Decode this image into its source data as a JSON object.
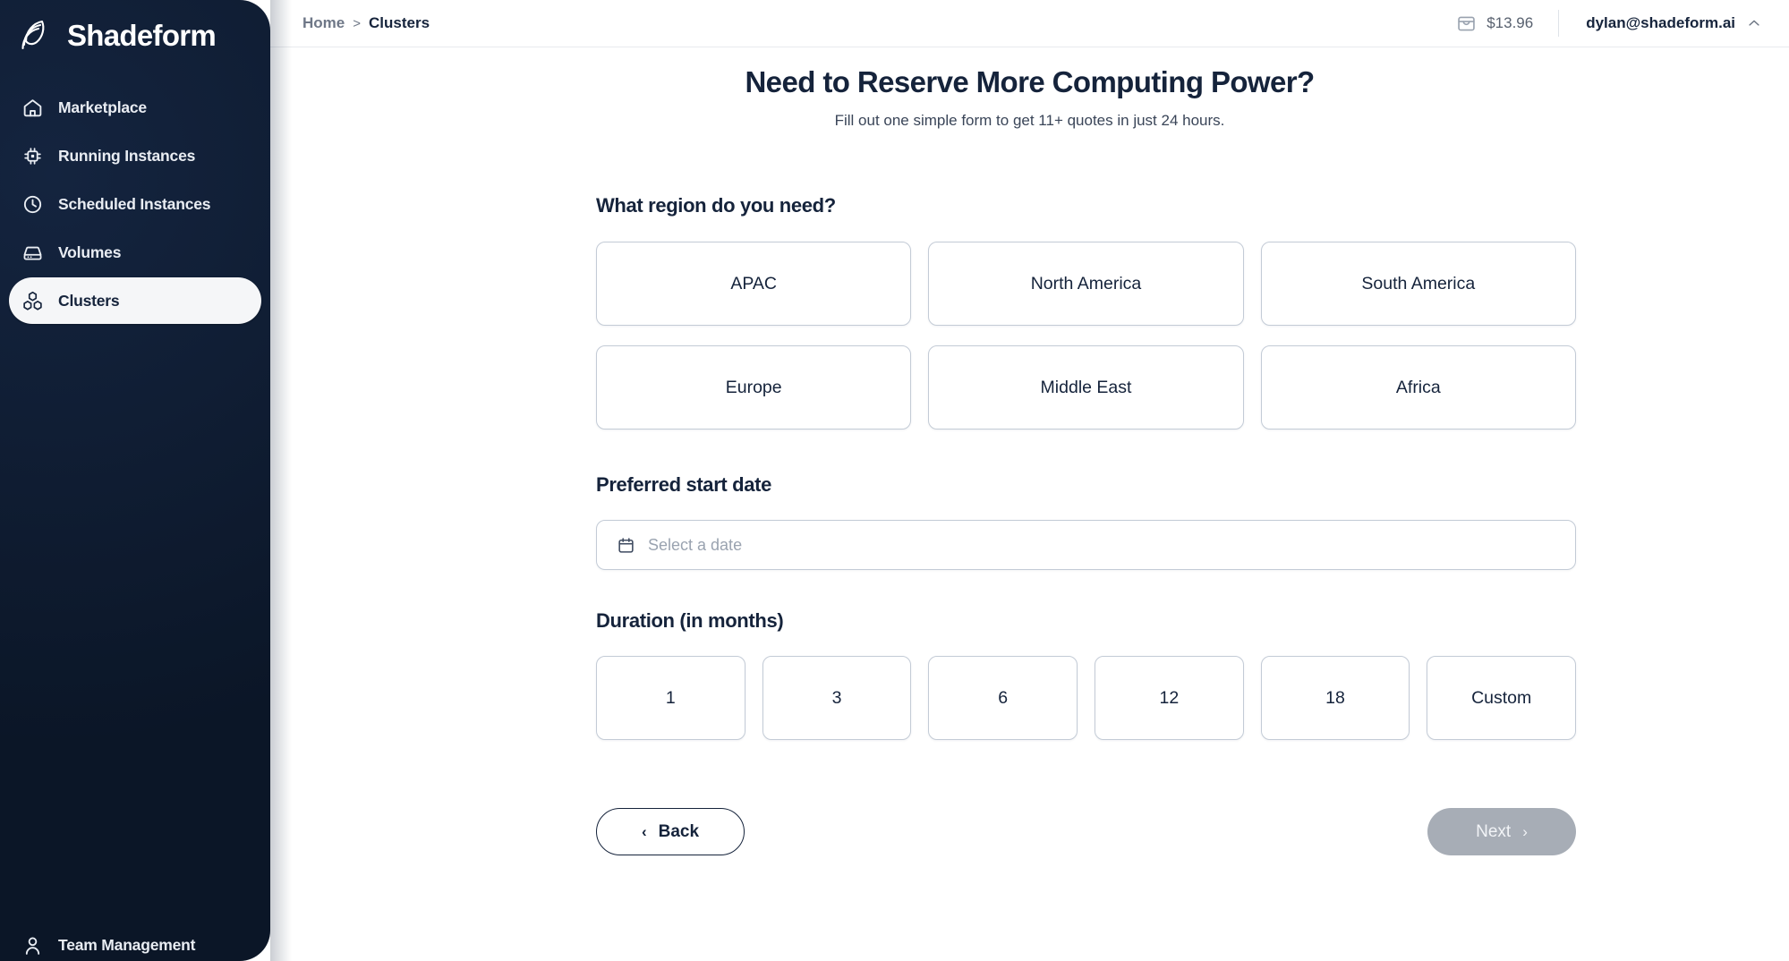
{
  "brand": {
    "name": "Shadeform",
    "logo_icon": "shadeform-logo-icon"
  },
  "sidebar": {
    "items": [
      {
        "label": "Marketplace",
        "icon": "home-icon",
        "active": false
      },
      {
        "label": "Running Instances",
        "icon": "chip-icon",
        "active": false
      },
      {
        "label": "Scheduled Instances",
        "icon": "clock-icon",
        "active": false
      },
      {
        "label": "Volumes",
        "icon": "drive-icon",
        "active": false
      },
      {
        "label": "Clusters",
        "icon": "cubes-icon",
        "active": true
      }
    ],
    "bottom_item": {
      "label": "Team Management",
      "icon": "user-icon"
    }
  },
  "topbar": {
    "breadcrumb": {
      "home": "Home",
      "separator": ">",
      "current": "Clusters"
    },
    "balance": {
      "icon": "inbox-icon",
      "amount": "$13.96"
    },
    "account": {
      "email": "dylan@shadeform.ai",
      "chevron": "chevron-up-icon"
    }
  },
  "page": {
    "title": "Need to Reserve More Computing Power?",
    "subtitle": "Fill out one simple form to get 11+ quotes in just 24 hours."
  },
  "region": {
    "label": "What region do you need?",
    "options": [
      "APAC",
      "North America",
      "South America",
      "Europe",
      "Middle East",
      "Africa"
    ]
  },
  "start_date": {
    "label": "Preferred start date",
    "placeholder": "Select a date",
    "value": "",
    "icon": "calendar-icon"
  },
  "duration": {
    "label": "Duration (in months)",
    "options": [
      "1",
      "3",
      "6",
      "12",
      "18",
      "Custom"
    ]
  },
  "actions": {
    "back": {
      "label": "Back",
      "icon": "chevron-left-icon"
    },
    "next": {
      "label": "Next",
      "icon": "chevron-right-icon",
      "disabled": true
    }
  },
  "colors": {
    "sidebar_bg": "#0d1c33",
    "text_dark": "#15233b",
    "border": "#c3cbd6",
    "next_disabled": "#a7adb6",
    "muted": "#6e7787"
  }
}
